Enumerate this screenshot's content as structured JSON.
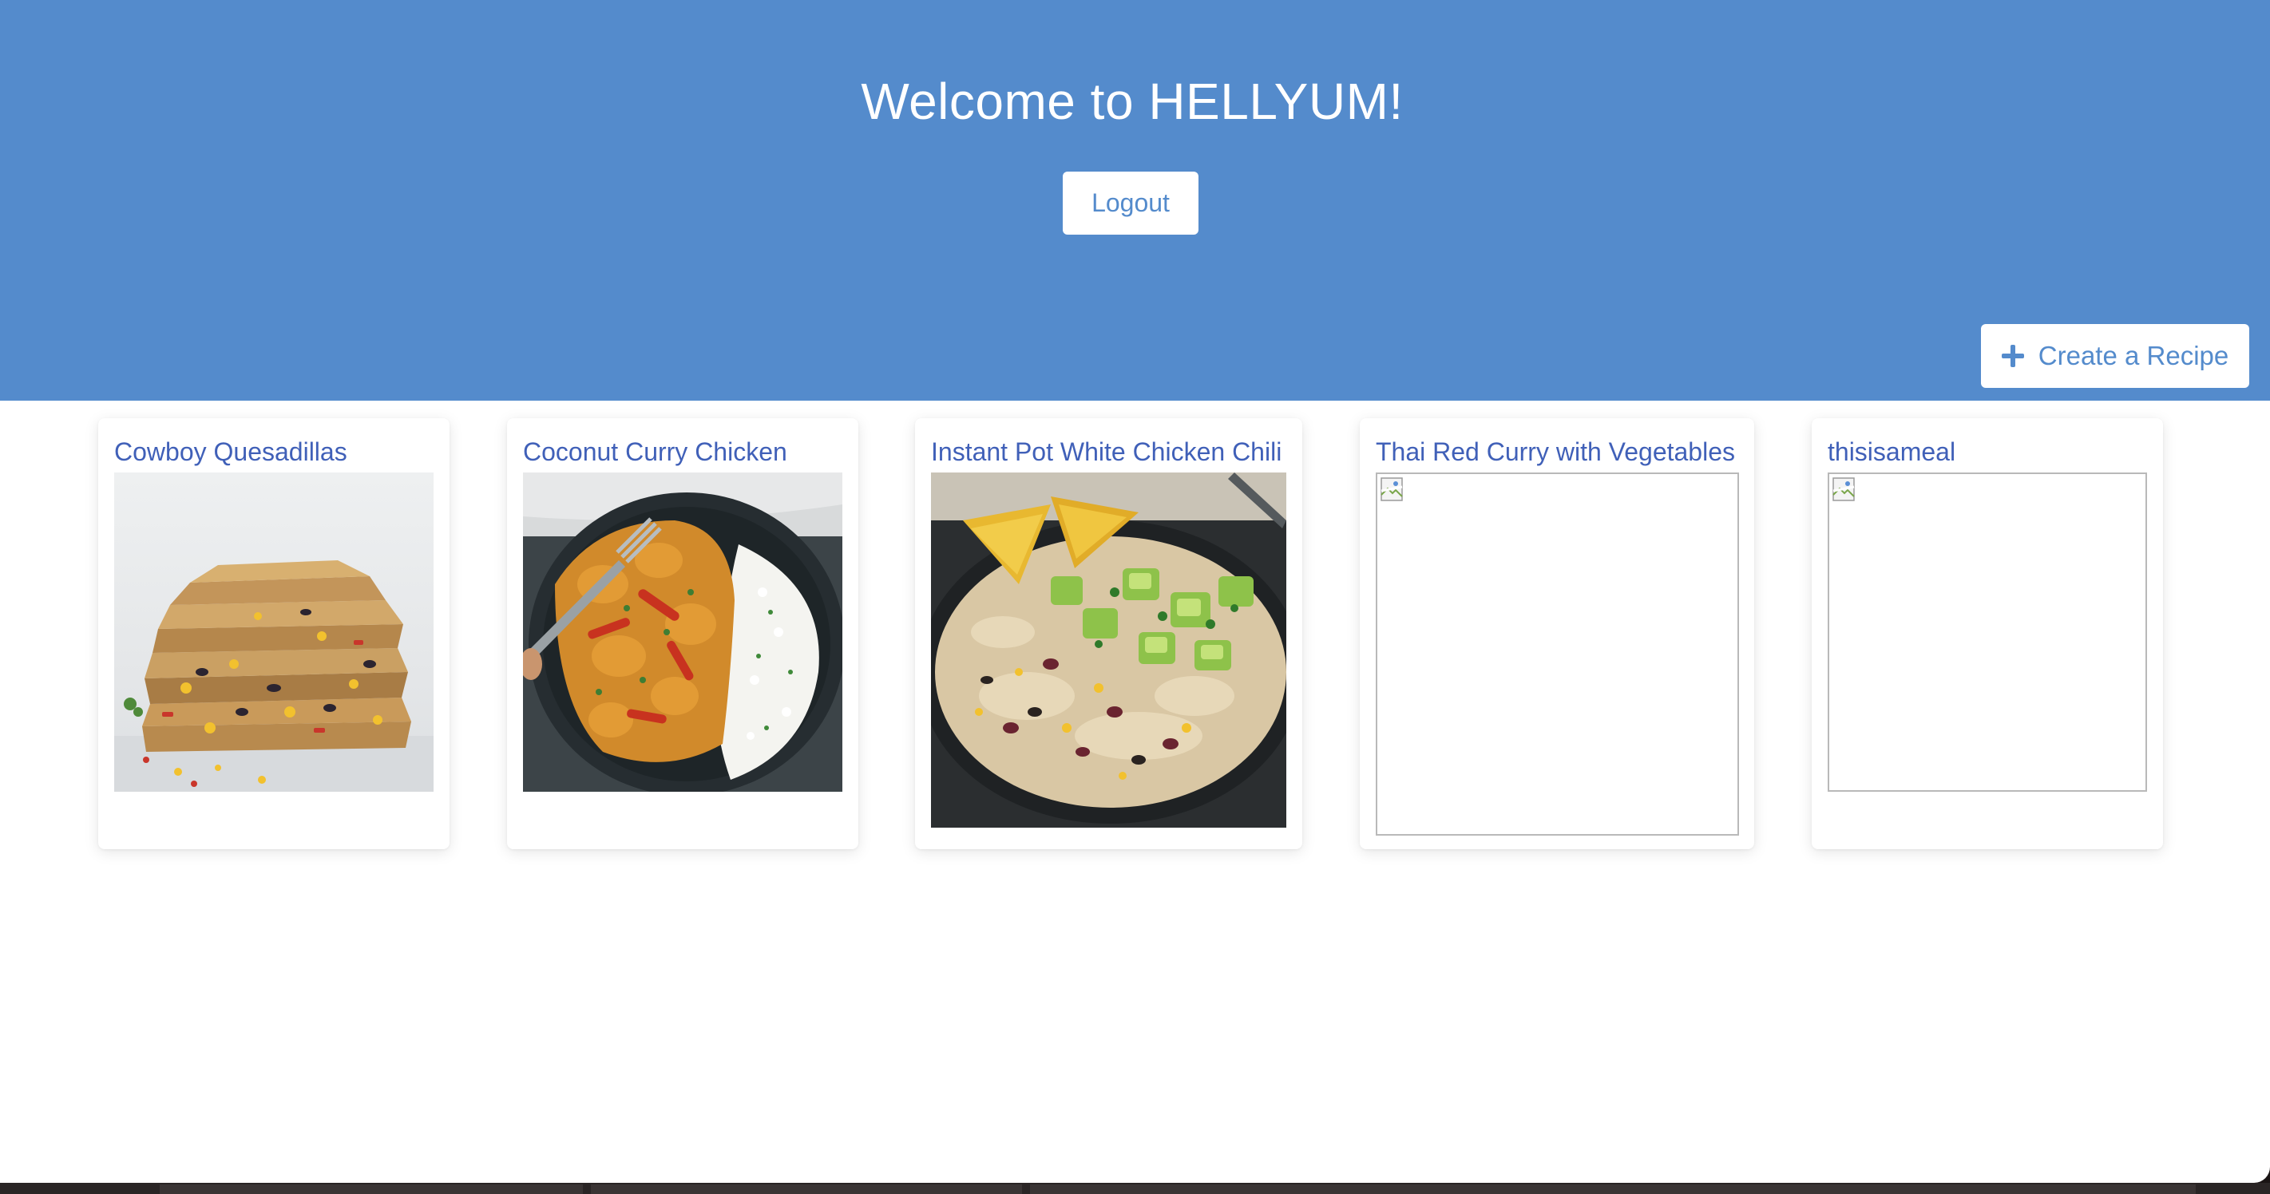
{
  "header": {
    "title": "Welcome to HELLYUM!",
    "logout_label": "Logout",
    "create_label": "Create a Recipe",
    "create_icon": "plus-icon",
    "background": "#548bcc"
  },
  "recipes": [
    {
      "title": "Cowboy Quesadillas",
      "image": "quesadillas-photo"
    },
    {
      "title": "Coconut Curry Chicken",
      "image": "curry-chicken-photo"
    },
    {
      "title": "Instant Pot White Chicken Chili",
      "image": "chicken-chili-photo"
    },
    {
      "title": "Thai Red Curry with Vegetables",
      "image": "broken-image"
    },
    {
      "title": "thisisameal",
      "image": "broken-image"
    }
  ],
  "colors": {
    "accent": "#548bcc",
    "link": "#4060b8"
  }
}
